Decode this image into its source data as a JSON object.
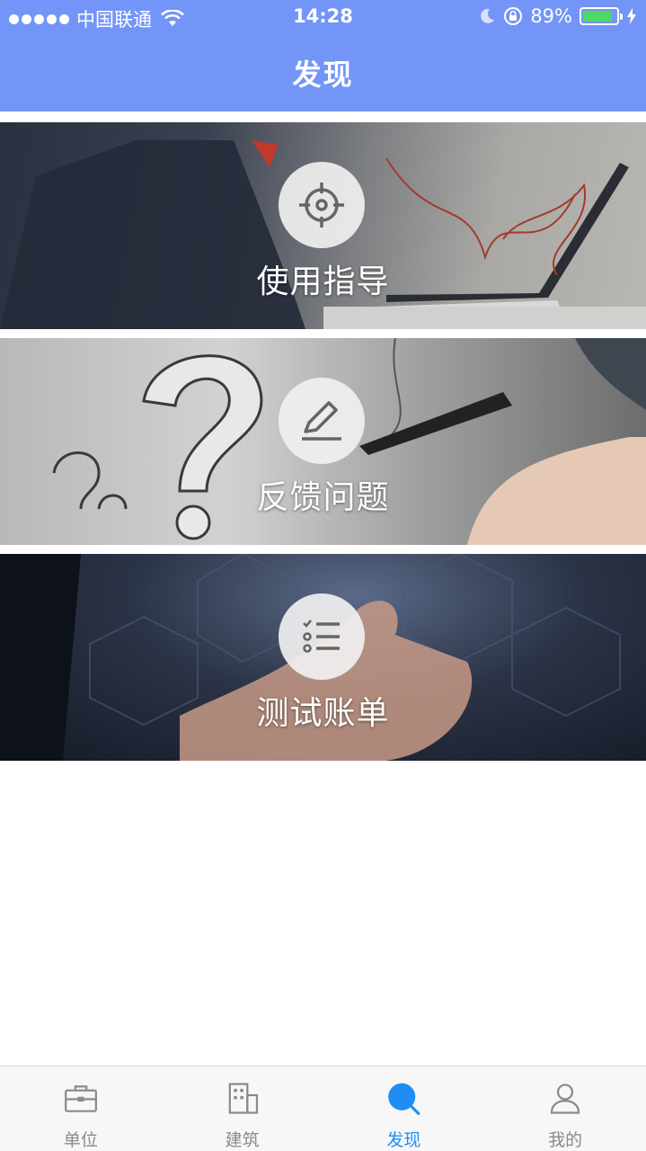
{
  "status_bar": {
    "carrier": "中国联通",
    "time": "14:28",
    "battery": "89%",
    "battery_level": 0.89
  },
  "header": {
    "title": "发现"
  },
  "cards": [
    {
      "label": "使用指导",
      "icon": "crosshair-icon"
    },
    {
      "label": "反馈问题",
      "icon": "pen-icon"
    },
    {
      "label": "测试账单",
      "icon": "checklist-icon"
    }
  ],
  "tabbar": {
    "tabs": [
      {
        "label": "单位",
        "icon": "briefcase-icon"
      },
      {
        "label": "建筑",
        "icon": "building-icon"
      },
      {
        "label": "发现",
        "icon": "search-icon",
        "active": true
      },
      {
        "label": "我的",
        "icon": "user-icon"
      }
    ],
    "active_color": "#1e8ef5",
    "inactive_color": "#8a8a8a"
  },
  "colors": {
    "header_bg": "#7395f7"
  }
}
